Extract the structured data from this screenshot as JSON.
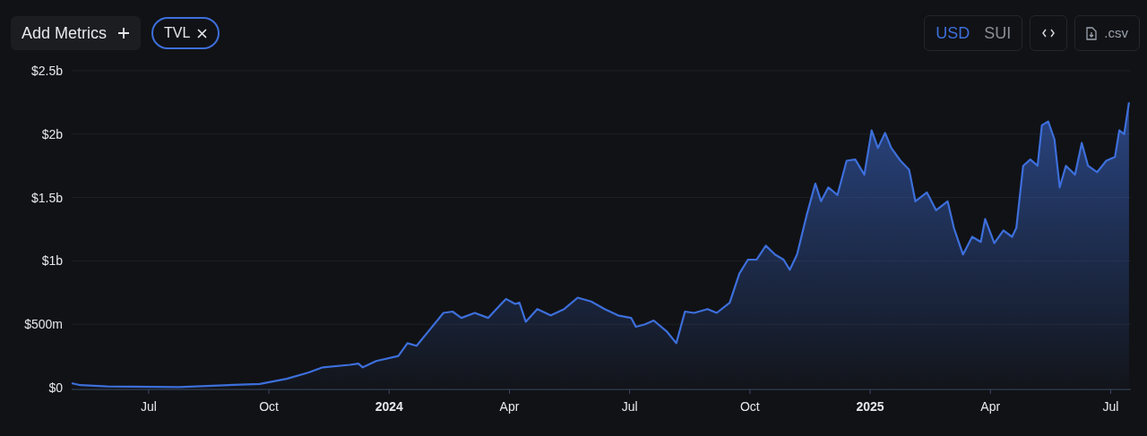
{
  "toolbar": {
    "add_metrics": {
      "label": "Add Metrics"
    },
    "metrics": [
      {
        "label": "TVL"
      }
    ],
    "currency_tabs": [
      {
        "label": "USD",
        "selected": true
      },
      {
        "label": "SUI",
        "selected": false
      }
    ],
    "csv_button": {
      "label": ".csv"
    }
  },
  "chart": {
    "chart_data": {
      "type": "area",
      "x": [
        2023.34,
        2023.358,
        2023.414,
        2023.563,
        2023.731,
        2023.787,
        2023.833,
        2023.862,
        2023.918,
        2023.936,
        2023.945,
        2023.973,
        2024.019,
        2024.038,
        2024.057,
        2024.085,
        2024.113,
        2024.132,
        2024.15,
        2024.178,
        2024.206,
        2024.233,
        2024.243,
        2024.262,
        2024.271,
        2024.284,
        2024.308,
        2024.336,
        2024.364,
        2024.392,
        2024.42,
        2024.448,
        2024.476,
        2024.503,
        2024.513,
        2024.532,
        2024.55,
        2024.578,
        2024.597,
        2024.615,
        2024.634,
        2024.662,
        2024.681,
        2024.708,
        2024.728,
        2024.746,
        2024.764,
        2024.783,
        2024.802,
        2024.82,
        2024.833,
        2024.848,
        2024.868,
        2024.886,
        2024.898,
        2024.913,
        2024.932,
        2024.951,
        2024.969,
        2024.988,
        2025.003,
        2025.016,
        2025.031,
        2025.044,
        2025.063,
        2025.081,
        2025.094,
        2025.118,
        2025.137,
        2025.161,
        2025.174,
        2025.193,
        2025.212,
        2025.23,
        2025.239,
        2025.258,
        2025.277,
        2025.295,
        2025.304,
        2025.318,
        2025.333,
        2025.348,
        2025.357,
        2025.37,
        2025.383,
        2025.394,
        2025.407,
        2025.426,
        2025.44,
        2025.453,
        2025.472,
        2025.491,
        2025.509,
        2025.518,
        2025.528,
        2025.538
      ],
      "series": [
        {
          "color": "#3d6fdb",
          "values": [
            35000000,
            20000000,
            10000000,
            5000000,
            30000000,
            70000000,
            120000000,
            160000000,
            180000000,
            190000000,
            160000000,
            210000000,
            250000000,
            350000000,
            330000000,
            460000000,
            590000000,
            600000000,
            550000000,
            590000000,
            550000000,
            660000000,
            700000000,
            660000000,
            670000000,
            520000000,
            620000000,
            570000000,
            620000000,
            710000000,
            680000000,
            620000000,
            570000000,
            550000000,
            480000000,
            500000000,
            530000000,
            440000000,
            350000000,
            600000000,
            590000000,
            620000000,
            590000000,
            670000000,
            900000000,
            1010000000,
            1010000000,
            1120000000,
            1050000000,
            1010000000,
            930000000,
            1050000000,
            1360000000,
            1610000000,
            1470000000,
            1580000000,
            1520000000,
            1790000000,
            1800000000,
            1680000000,
            2030000000,
            1890000000,
            2010000000,
            1890000000,
            1790000000,
            1720000000,
            1470000000,
            1540000000,
            1400000000,
            1470000000,
            1260000000,
            1050000000,
            1190000000,
            1150000000,
            1330000000,
            1140000000,
            1240000000,
            1190000000,
            1260000000,
            1750000000,
            1800000000,
            1750000000,
            2070000000,
            2100000000,
            1960000000,
            1580000000,
            1750000000,
            1680000000,
            1930000000,
            1750000000,
            1700000000,
            1790000000,
            1820000000,
            2030000000,
            2000000000,
            2250000000
          ]
        }
      ],
      "grid": true,
      "xlim": [
        2023.34,
        2025.542
      ],
      "ylim": [
        0,
        2500000000
      ],
      "xticks": [
        {
          "value": 2023.5,
          "label": "Jul"
        },
        {
          "value": 2023.75,
          "label": "Oct"
        },
        2024,
        {
          "value": 2024.25,
          "label": "Apr"
        },
        {
          "value": 2024.5,
          "label": "Jul"
        },
        {
          "value": 2024.75,
          "label": "Oct"
        },
        2025,
        {
          "value": 2025.25,
          "label": "Apr"
        },
        {
          "value": 2025.5,
          "label": "Jul"
        }
      ],
      "yticks": [
        {
          "value": 0,
          "label": "$0"
        },
        {
          "value": 500000000,
          "label": "$500m"
        },
        {
          "value": 1000000000,
          "label": "$1b"
        },
        {
          "value": 1500000000,
          "label": "$1.5b"
        },
        {
          "value": 2000000000,
          "label": "$2b"
        },
        {
          "value": 2500000000,
          "label": "$2.5b"
        }
      ]
    }
  }
}
